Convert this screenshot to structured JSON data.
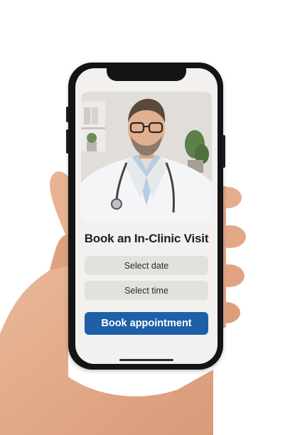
{
  "booking": {
    "title": "Book an In-Clinic Visit",
    "date_button": "Select date",
    "time_button": "Select time",
    "book_button": "Book appointment"
  },
  "colors": {
    "primary": "#1f5fa8",
    "secondary_button": "#e2e1de",
    "screen_background": "#f2f1ef",
    "device_frame": "#121416"
  },
  "icons": [
    "doctor-photo",
    "hand"
  ]
}
